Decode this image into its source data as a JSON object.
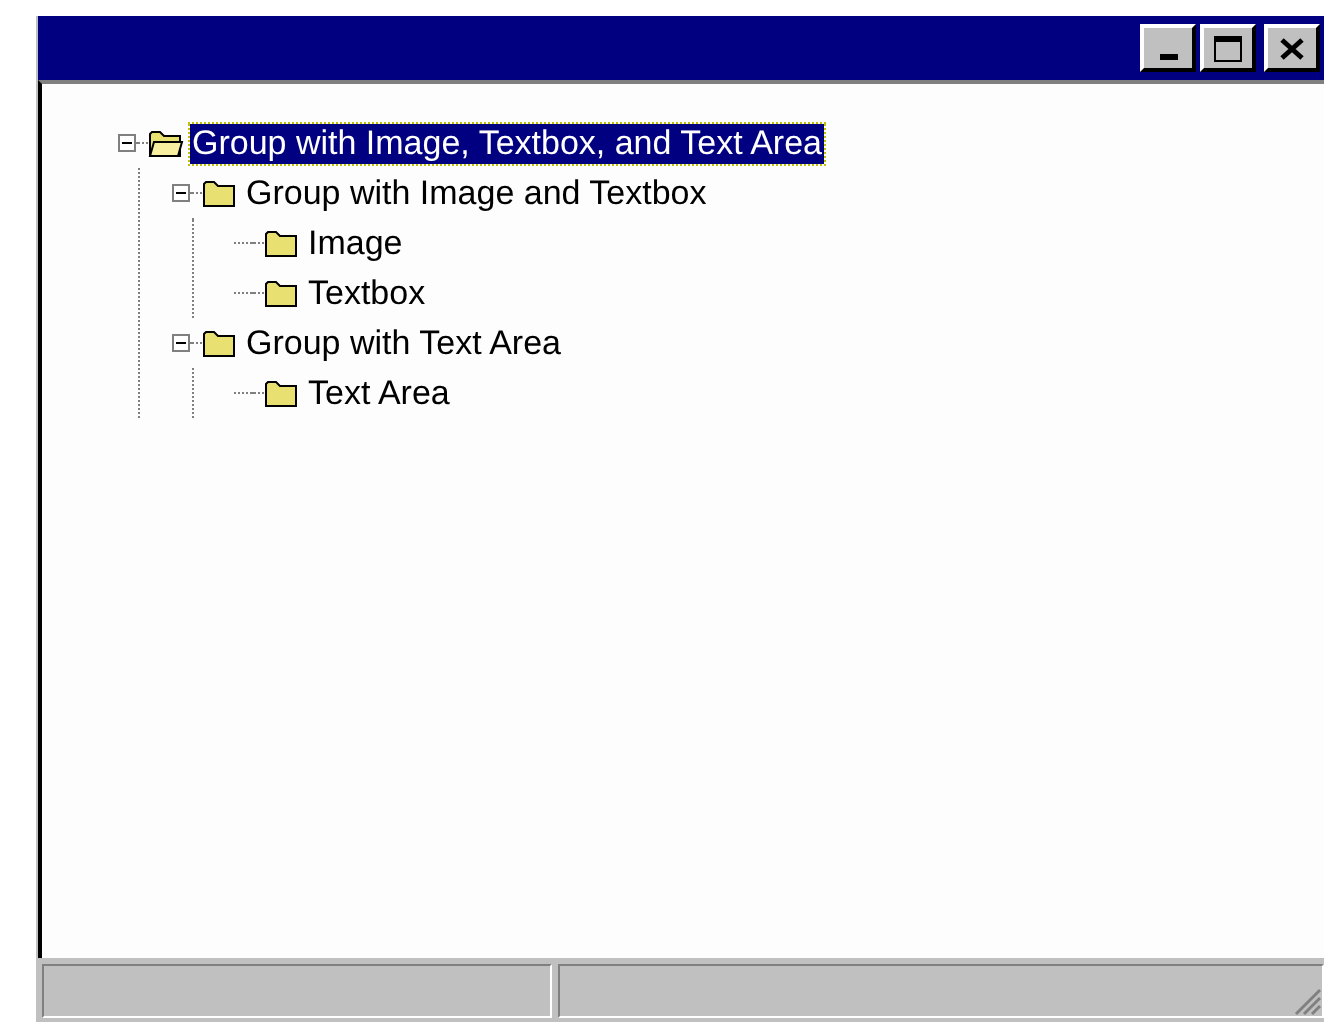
{
  "tree": [
    {
      "label": "Group with Image, Textbox, and Text Area",
      "selected": true,
      "expanded": true,
      "children": [
        {
          "label": "Group with Image and Textbox",
          "selected": false,
          "expanded": true,
          "children": [
            {
              "label": "Image",
              "selected": false
            },
            {
              "label": "Textbox",
              "selected": false
            }
          ]
        },
        {
          "label": "Group with Text Area",
          "selected": false,
          "expanded": true,
          "children": [
            {
              "label": "Text Area",
              "selected": false
            }
          ]
        }
      ]
    }
  ],
  "status_bar": {
    "panes": [
      {
        "kind": "plain"
      },
      {
        "kind": "grip"
      }
    ]
  }
}
